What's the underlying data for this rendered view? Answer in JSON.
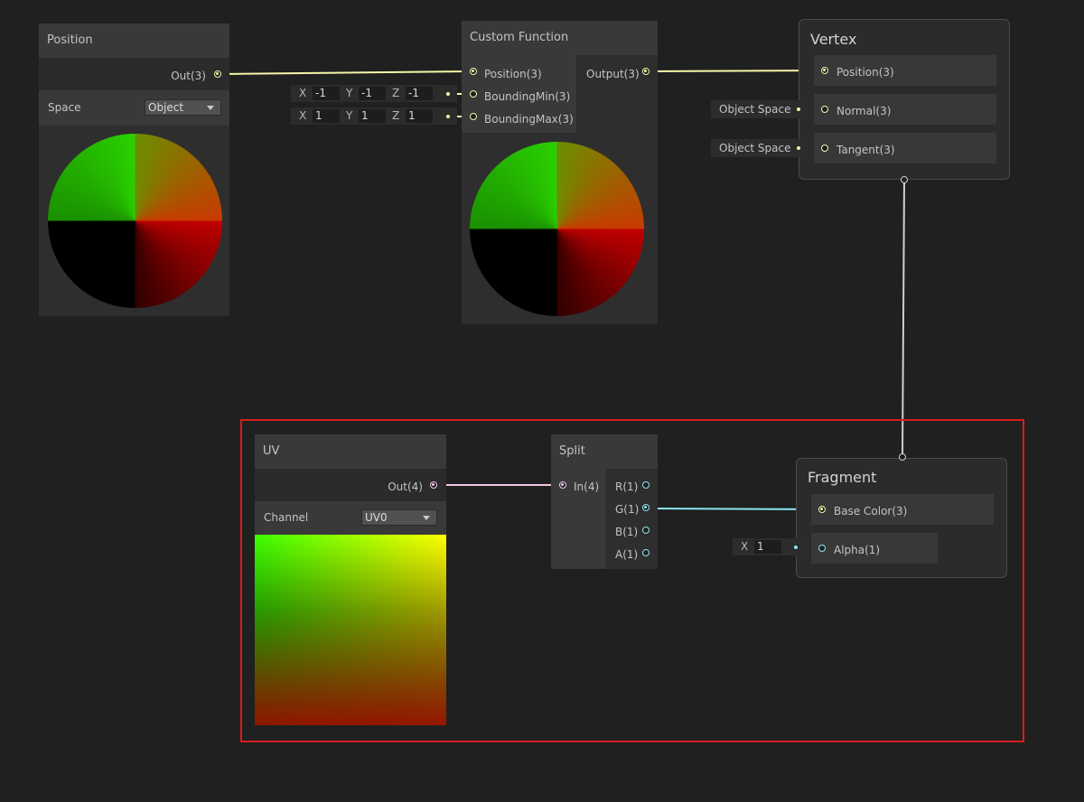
{
  "position_node": {
    "title": "Position",
    "out_label": "Out(3)",
    "space_label": "Space",
    "space_value": "Object"
  },
  "custom_function_node": {
    "title": "Custom Function",
    "inputs": [
      "Position(3)",
      "BoundingMin(3)",
      "BoundingMax(3)"
    ],
    "output": "Output(3)",
    "bounding_min": {
      "x_label": "X",
      "x": "-1",
      "y_label": "Y",
      "y": "-1",
      "z_label": "Z",
      "z": "-1"
    },
    "bounding_max": {
      "x_label": "X",
      "x": "1",
      "y_label": "Y",
      "y": "1",
      "z_label": "Z",
      "z": "1"
    }
  },
  "vertex_node": {
    "title": "Vertex",
    "ports": [
      "Position(3)",
      "Normal(3)",
      "Tangent(3)"
    ],
    "normal_space": "Object Space",
    "tangent_space": "Object Space"
  },
  "uv_node": {
    "title": "UV",
    "out_label": "Out(4)",
    "channel_label": "Channel",
    "channel_value": "UV0"
  },
  "split_node": {
    "title": "Split",
    "input": "In(4)",
    "outputs": [
      "R(1)",
      "G(1)",
      "B(1)",
      "A(1)"
    ]
  },
  "fragment_node": {
    "title": "Fragment",
    "ports": [
      "Base Color(3)",
      "Alpha(1)"
    ],
    "alpha_field": {
      "x_label": "X",
      "x": "1"
    }
  },
  "colors": {
    "background": "#202020",
    "wire_vector3": "#f4f7a8",
    "wire_vector4": "#f2c7e8",
    "wire_float": "#8be7ef",
    "wire_stage": "#cfcfcf",
    "highlight_box": "#d61e1e"
  }
}
